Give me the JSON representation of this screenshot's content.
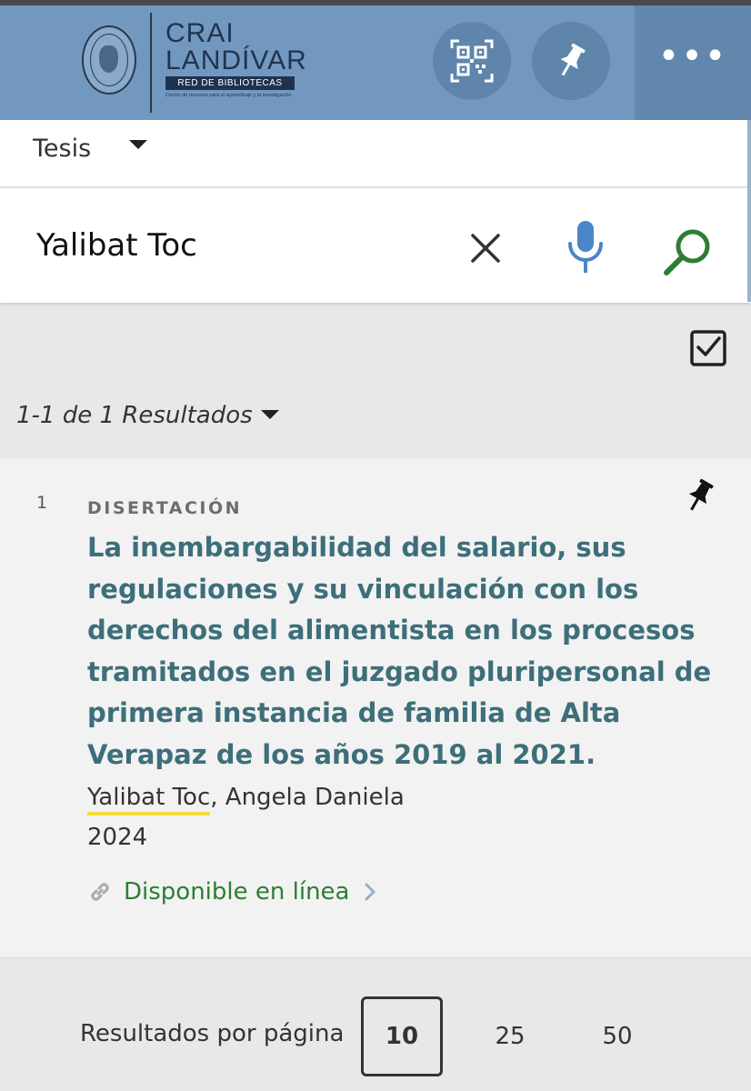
{
  "header": {
    "logo_line1": "CRAI",
    "logo_line2": "LANDÍVAR",
    "logo_subtitle": "RED DE BIBLIOTECAS",
    "logo_tagline": "Centro de recursos para el aprendizaje y la investigación",
    "more_label": "•••"
  },
  "scope": {
    "selected": "Tesis"
  },
  "search": {
    "query": "Yalibat Toc"
  },
  "results": {
    "count_text": "1-1 de 1 Resultados",
    "items": [
      {
        "index": "1",
        "type": "DISERTACIÓN",
        "title": "La inembargabilidad del salario, sus regulaciones y su vinculación con los derechos del alimentista en los procesos tramitados en el juzgado pluripersonal de primera instancia de familia de Alta Verapaz de los años 2019 al 2021.",
        "author_highlight": "Yalibat Toc",
        "author_rest": ", Angela Daniela",
        "year": "2024",
        "availability": "Disponible en línea"
      }
    ]
  },
  "pagination": {
    "label": "Resultados por página",
    "options": [
      "10",
      "25",
      "50"
    ],
    "selected": "10"
  },
  "colors": {
    "header_bg": "#7398bf",
    "title": "#3d6f7a",
    "available": "#2e7d32",
    "mic": "#4a86c8",
    "search_icon": "#2e7d32",
    "highlight": "#f5dd3a"
  }
}
